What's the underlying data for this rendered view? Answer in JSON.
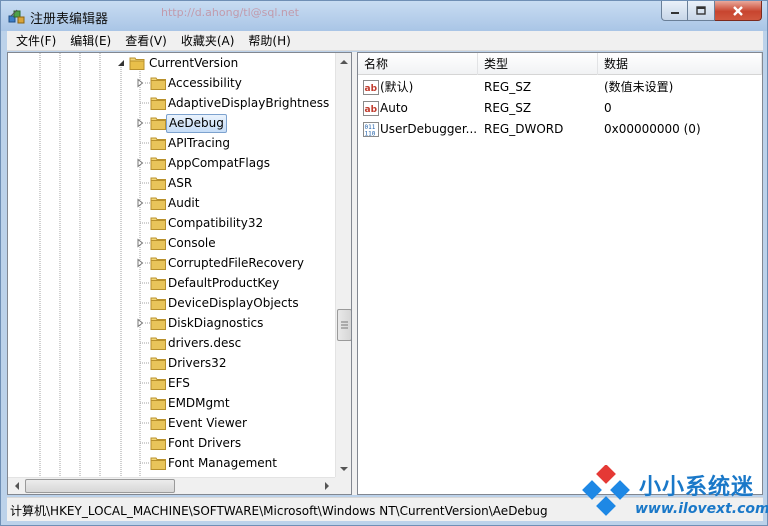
{
  "window": {
    "title": "注册表编辑器",
    "title_extra": "http://d.ahong/tl@sql.net",
    "buttons": {
      "minimize": "minimize-icon",
      "maximize": "maximize-icon",
      "close": "close-icon"
    }
  },
  "menu": [
    {
      "label": "文件(F)"
    },
    {
      "label": "编辑(E)"
    },
    {
      "label": "查看(V)"
    },
    {
      "label": "收藏夹(A)"
    },
    {
      "label": "帮助(H)"
    }
  ],
  "tree": {
    "parent": "CurrentVersion",
    "items": [
      {
        "label": "Accessibility",
        "expandable": true
      },
      {
        "label": "AdaptiveDisplayBrightness",
        "expandable": false
      },
      {
        "label": "AeDebug",
        "expandable": true,
        "selected": true
      },
      {
        "label": "APITracing",
        "expandable": false
      },
      {
        "label": "AppCompatFlags",
        "expandable": true
      },
      {
        "label": "ASR",
        "expandable": false
      },
      {
        "label": "Audit",
        "expandable": true
      },
      {
        "label": "Compatibility32",
        "expandable": false
      },
      {
        "label": "Console",
        "expandable": true
      },
      {
        "label": "CorruptedFileRecovery",
        "expandable": true
      },
      {
        "label": "DefaultProductKey",
        "expandable": false
      },
      {
        "label": "DeviceDisplayObjects",
        "expandable": false
      },
      {
        "label": "DiskDiagnostics",
        "expandable": true
      },
      {
        "label": "drivers.desc",
        "expandable": false
      },
      {
        "label": "Drivers32",
        "expandable": false
      },
      {
        "label": "EFS",
        "expandable": false
      },
      {
        "label": "EMDMgmt",
        "expandable": false
      },
      {
        "label": "Event Viewer",
        "expandable": false
      },
      {
        "label": "Font Drivers",
        "expandable": false
      },
      {
        "label": "Font Management",
        "expandable": false
      }
    ]
  },
  "list": {
    "columns": [
      "名称",
      "类型",
      "数据"
    ],
    "rows": [
      {
        "name": "(默认)",
        "type": "REG_SZ",
        "data": "(数值未设置)",
        "icon": "string-value-icon"
      },
      {
        "name": "Auto",
        "type": "REG_SZ",
        "data": "0",
        "icon": "string-value-icon"
      },
      {
        "name": "UserDebugger...",
        "type": "REG_DWORD",
        "data": "0x00000000 (0)",
        "icon": "binary-value-icon"
      }
    ]
  },
  "status": {
    "path": "计算机\\HKEY_LOCAL_MACHINE\\SOFTWARE\\Microsoft\\Windows NT\\CurrentVersion\\AeDebug"
  },
  "watermark": {
    "title": "小小系统迷",
    "url": "www.ilovext.com"
  },
  "colors": {
    "title_bar": "#b9d1ea",
    "selection": "#cce4f7",
    "folder": "#e8c45a",
    "close_button": "#c8452f",
    "watermark": "#1a78c8"
  }
}
